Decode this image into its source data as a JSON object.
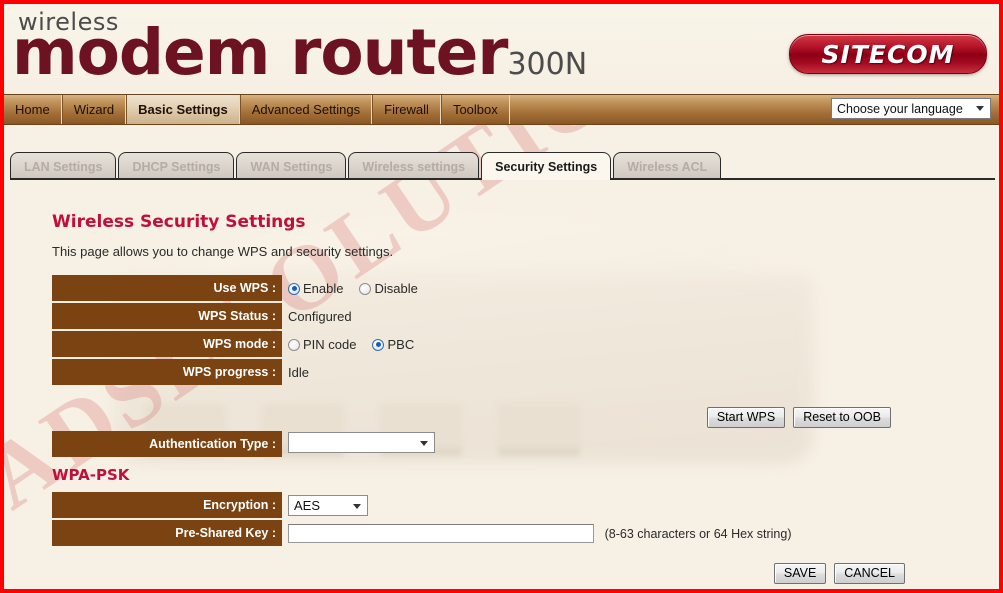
{
  "header": {
    "eyebrow": "wireless",
    "product": "modem router",
    "model": "300N",
    "logo": "SITECOM"
  },
  "nav": {
    "items": [
      {
        "label": "Home",
        "active": false
      },
      {
        "label": "Wizard",
        "active": false
      },
      {
        "label": "Basic Settings",
        "active": true
      },
      {
        "label": "Advanced Settings",
        "active": false
      },
      {
        "label": "Firewall",
        "active": false
      },
      {
        "label": "Toolbox",
        "active": false
      }
    ],
    "language_label": "Choose your language"
  },
  "tabs": [
    {
      "label": "LAN Settings",
      "active": false
    },
    {
      "label": "DHCP Settings",
      "active": false
    },
    {
      "label": "WAN Settings",
      "active": false
    },
    {
      "label": "Wireless settings",
      "active": false
    },
    {
      "label": "Security Settings",
      "active": true
    },
    {
      "label": "Wireless ACL",
      "active": false
    }
  ],
  "page": {
    "title": "Wireless Security Settings",
    "description": "This page allows you to change WPS and security settings."
  },
  "form": {
    "use_wps_label": "Use WPS :",
    "use_wps_enable": "Enable",
    "use_wps_disable": "Disable",
    "wps_status_label": "WPS Status :",
    "wps_status_value": "Configured",
    "wps_mode_label": "WPS mode :",
    "wps_mode_pin": "PIN code",
    "wps_mode_pbc": "PBC",
    "wps_progress_label": "WPS progress :",
    "wps_progress_value": "Idle",
    "auth_type_label": "Authentication Type :",
    "auth_type_value": "",
    "section_wpa_psk": "WPA-PSK",
    "encryption_label": "Encryption :",
    "encryption_value": "AES",
    "psk_label": "Pre-Shared Key :",
    "psk_value": "",
    "psk_hint": "(8-63 characters or 64 Hex string)"
  },
  "buttons": {
    "start_wps": "Start WPS",
    "reset_oob": "Reset to OOB",
    "save": "SAVE",
    "cancel": "CANCEL"
  },
  "watermark": {
    "text": "ADSL SOLUTION"
  },
  "colors": {
    "accent_red": "#c0103a",
    "label_brown": "#7a4311",
    "nav_brown": "#a5713a",
    "brand_maroon": "#6d1220",
    "border_red": "#ff0000"
  }
}
